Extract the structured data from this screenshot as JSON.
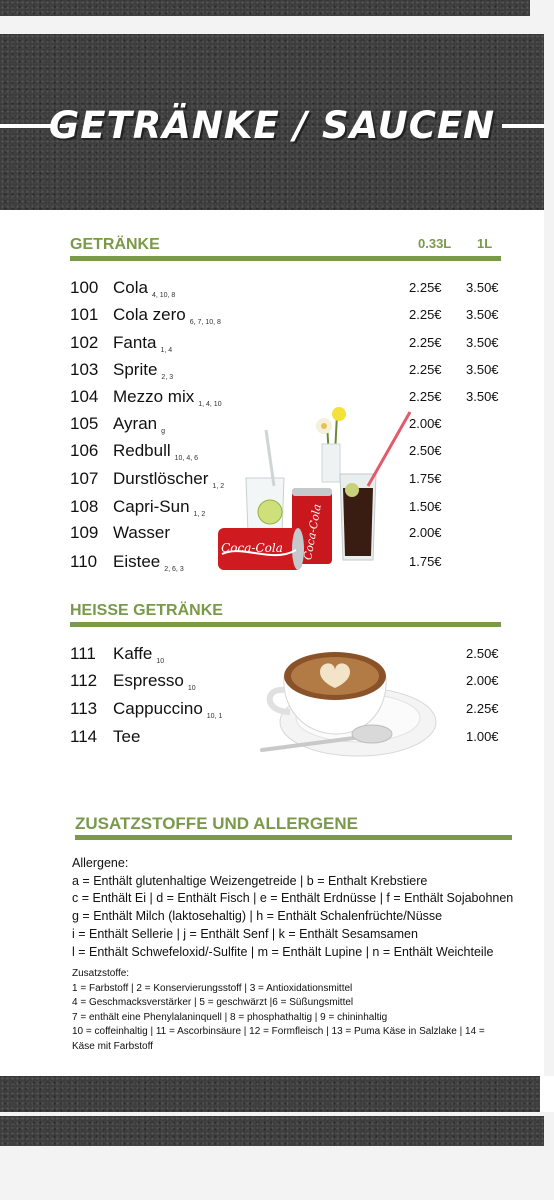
{
  "header": {
    "title": "GETRÄNKE / SAUCEN"
  },
  "drinks": {
    "section_title": "GETRÄNKE",
    "col1": "0.33L",
    "col2": "1L",
    "items": [
      {
        "num": "100",
        "name": "Cola",
        "codes": "4, 10, 8",
        "p1": "2.25€",
        "p2": "3.50€"
      },
      {
        "num": "101",
        "name": "Cola zero",
        "codes": "6, 7, 10, 8",
        "p1": "2.25€",
        "p2": "3.50€"
      },
      {
        "num": "102",
        "name": "Fanta",
        "codes": "1, 4",
        "p1": "2.25€",
        "p2": "3.50€"
      },
      {
        "num": "103",
        "name": "Sprite",
        "codes": "2, 3",
        "p1": "2.25€",
        "p2": "3.50€"
      },
      {
        "num": "104",
        "name": "Mezzo mix",
        "codes": "1, 4, 10",
        "p1": "2.25€",
        "p2": "3.50€"
      },
      {
        "num": "105",
        "name": "Ayran",
        "codes": "g",
        "p1": "2.00€",
        "p2": ""
      },
      {
        "num": "106",
        "name": "Redbull",
        "codes": "10, 4, 6",
        "p1": "2.50€",
        "p2": ""
      },
      {
        "num": "107",
        "name": "Durstlöscher",
        "codes": "1, 2",
        "p1": "1.75€",
        "p2": ""
      },
      {
        "num": "108",
        "name": "Capri-Sun",
        "codes": "1, 2",
        "p1": "1.50€",
        "p2": ""
      },
      {
        "num": "109",
        "name": "Wasser",
        "codes": "",
        "p1": "2.00€",
        "p2": ""
      },
      {
        "num": "110",
        "name": "Eistee",
        "codes": "2, 6, 3",
        "p1": "1.75€",
        "p2": ""
      }
    ]
  },
  "hot": {
    "section_title": "HEISSE GETRÄNKE",
    "items": [
      {
        "num": "111",
        "name": "Kaffe",
        "codes": "10",
        "price": "2.50€"
      },
      {
        "num": "112",
        "name": "Espresso",
        "codes": "10",
        "price": "2.00€"
      },
      {
        "num": "113",
        "name": "Cappuccino",
        "codes": "10, 1",
        "price": "2.25€"
      },
      {
        "num": "114",
        "name": "Tee",
        "codes": "",
        "price": "1.00€"
      }
    ]
  },
  "allergens": {
    "section_title": "ZUSATZSTOFFE UND ALLERGENE",
    "heading": "Allergene:",
    "lines": [
      "a = Enthält glutenhaltige Weizengetreide | b = Enthalt Krebstiere",
      "c = Enthält Ei | d = Enthält Fisch | e = Enthält Erdnüsse | f = Enthält Sojabohnen",
      "g = Enthält Milch (laktosehaltig) | h = Enthält Schalenfrüchte/Nüsse",
      "i = Enthält Sellerie | j = Enthält Senf | k = Enthält Sesamsamen",
      "l = Enthält Schwefeloxid/-Sulfite | m = Enthält Lupine | n = Enthält Weichteile"
    ],
    "additives_heading": "Zusatzstoffe:",
    "additives_lines": [
      "1 = Farbstoff | 2 = Konservierungsstoff | 3 = Antioxidationsmittel",
      "4 = Geschmacksverstärker | 5 = geschwärzt |6 = Süßungsmittel",
      "7 = enthält eine Phenylalaninquell | 8 = phosphathaltig | 9 = chininhaltig",
      "10 = coffeinhaltig | 11 = Ascorbinsäure | 12 = Formfleisch | 13 = Puma Käse in Salzlake | 14 =",
      "Käse mit Farbstoff"
    ]
  },
  "images": {
    "drinks": "cola-cans-and-glasses-image",
    "coffee": "cappuccino-cup-image"
  }
}
